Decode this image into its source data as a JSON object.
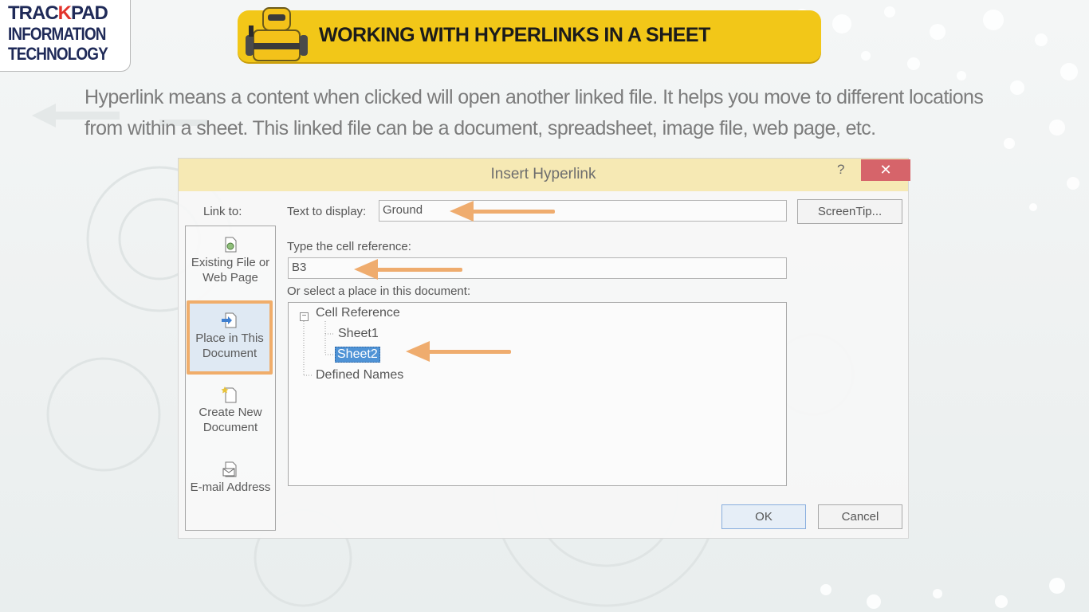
{
  "logo": {
    "line1_a": "TRAC",
    "line1_k": "K",
    "line1_b": "PAD",
    "line2": "INFORMATION",
    "line3": "TECHNOLOGY"
  },
  "banner": {
    "title": "WORKING WITH HYPERLINKS IN A SHEET"
  },
  "intro": "Hyperlink means a content when clicked will open another linked file. It helps you move to different locations from within a sheet. This linked file can be a document, spreadsheet, image file, web page, etc.",
  "dialog": {
    "title": "Insert Hyperlink",
    "help": "?",
    "close": "✕",
    "link_to_label": "Link to:",
    "link_to_items": [
      {
        "label": "Existing File or Web Page",
        "icon": "existing-file-icon"
      },
      {
        "label": "Place in This Document",
        "icon": "place-in-document-icon"
      },
      {
        "label": "Create New Document",
        "icon": "new-document-icon"
      },
      {
        "label": "E-mail Address",
        "icon": "email-icon"
      }
    ],
    "text_to_display_label": "Text to display:",
    "text_to_display_value": "Ground",
    "screentip_label": "ScreenTip...",
    "cell_ref_label": "Type the cell reference:",
    "cell_ref_value": "B3",
    "place_label": "Or select a place in this document:",
    "tree": {
      "expander": "−",
      "root": "Cell Reference",
      "children": [
        "Sheet1",
        "Sheet2"
      ],
      "selected": "Sheet2",
      "other_root": "Defined Names"
    },
    "ok_label": "OK",
    "cancel_label": "Cancel"
  },
  "colors": {
    "banner": "#f2c718",
    "highlight_border": "#f0ad6a",
    "arrow": "#efac6e",
    "selection": "#4f93d6"
  }
}
